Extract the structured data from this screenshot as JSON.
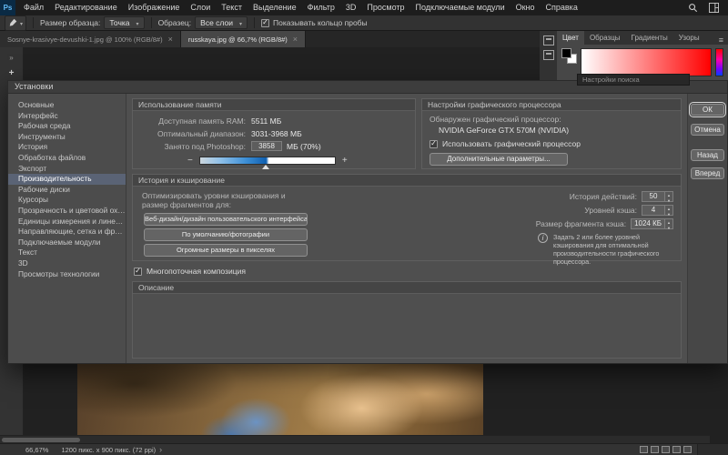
{
  "menu_bar": {
    "logo": "Ps",
    "items": [
      "Файл",
      "Редактирование",
      "Изображение",
      "Слои",
      "Текст",
      "Выделение",
      "Фильтр",
      "3D",
      "Просмотр",
      "Подключаемые модули",
      "Окно",
      "Справка"
    ]
  },
  "options_bar": {
    "sample_size_label": "Размер образца:",
    "sample_size_value": "Точка",
    "sample_label": "Образец:",
    "sample_value": "Все слои",
    "show_ring_label": "Показывать кольцо пробы"
  },
  "document_tabs": {
    "tab1": "Sosnye-krasivye-devushki-1.jpg @ 100% (RGB/8#)",
    "tab2": "russkaya.jpg @ 66,7% (RGB/8#)"
  },
  "panel_dock": {
    "tab_color": "Цвет",
    "tab_swatches": "Образцы",
    "tab_gradients": "Градиенты",
    "tab_patterns": "Узоры",
    "search_placeholder": "Настройки поиска"
  },
  "prefs": {
    "title": "Установки",
    "nav": [
      "Основные",
      "Интерфейс",
      "Рабочая среда",
      "Инструменты",
      "История",
      "Обработка файлов",
      "Экспорт",
      "Производительность",
      "Рабочие диски",
      "Курсоры",
      "Прозрачность и цветовой охват",
      "Единицы измерения и линейки",
      "Направляющие, сетка и фрагменты",
      "Подключаемые модули",
      "Текст",
      "3D",
      "Просмотры технологии"
    ],
    "memory": {
      "header": "Использование памяти",
      "available_label": "Доступная память RAM:",
      "available_value": "5511 МБ",
      "range_label": "Оптимальный диапазон:",
      "range_value": "3031-3968 МБ",
      "used_label": "Занято под Photoshop:",
      "used_value": "3858",
      "used_suffix": "МБ (70%)",
      "minus": "−",
      "plus": "+"
    },
    "gpu": {
      "header": "Настройки графического процессора",
      "detected_label": "Обнаружен графический процессор:",
      "gpu_name": "NVIDIA GeForce GTX 570M (NVIDIA)",
      "use_gpu_label": "Использовать графический процессор",
      "advanced_button": "Дополнительные параметры..."
    },
    "history_cache": {
      "header": "История и кэширование",
      "optimize_label": "Оптимизировать уровни кэширования и размер фрагментов для:",
      "btn_web": "Веб-дизайн/дизайн пользовательского интерфейса",
      "btn_default": "По умолчанию/фотографии",
      "btn_huge": "Огромные размеры в пикселях",
      "history_label": "История действий:",
      "history_value": "50",
      "cache_levels_label": "Уровней кэша:",
      "cache_levels_value": "4",
      "tile_label": "Размер фрагмента кэша:",
      "tile_value": "1024 КБ",
      "info_text": "Задать 2 или более уровней кэширования для оптимальной производительности графического процессора."
    },
    "multithreaded_label": "Многопоточная композиция",
    "description_header": "Описание",
    "buttons": {
      "ok": "ОК",
      "cancel": "Отмена",
      "back": "Назад",
      "forward": "Вперед"
    }
  },
  "status_bar": {
    "zoom": "66,67%",
    "doc_info": "1200 пикс. x 900 пикс. (72 ppi)"
  }
}
